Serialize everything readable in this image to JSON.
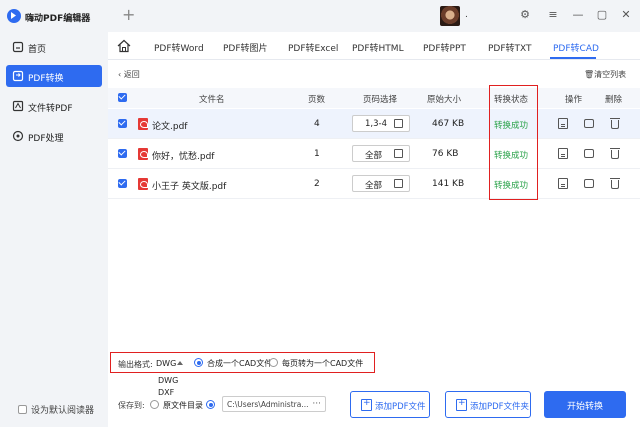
{
  "app": {
    "title": "嗨动PDF编辑器",
    "new_tab": "+",
    "username": "."
  },
  "window": {
    "minimize": "—",
    "restore": "▢",
    "close": "✕",
    "settings": "⚙",
    "menu": "≡"
  },
  "sidebar": {
    "items": [
      {
        "label": "首页",
        "icon": "home-icon"
      },
      {
        "label": "PDF转换",
        "icon": "convert-icon",
        "active": true
      },
      {
        "label": "文件转PDF",
        "icon": "file-to-pdf-icon"
      },
      {
        "label": "PDF处理",
        "icon": "pdf-process-icon"
      }
    ],
    "default_reader": "设为默认阅读器"
  },
  "tabs": [
    {
      "label": "PDF转Word"
    },
    {
      "label": "PDF转图片"
    },
    {
      "label": "PDF转Excel"
    },
    {
      "label": "PDF转HTML"
    },
    {
      "label": "PDF转PPT"
    },
    {
      "label": "PDF转TXT"
    },
    {
      "label": "PDF转CAD",
      "active": true
    }
  ],
  "toolbar": {
    "back": "返回",
    "clear": "清空列表"
  },
  "table": {
    "headers": {
      "filename": "文件名",
      "pages": "页数",
      "page_select": "页码选择",
      "size": "原始大小",
      "status": "转换状态",
      "actions": "操作",
      "delete": "删除"
    },
    "rows": [
      {
        "name": "论文.pdf",
        "pages": "4",
        "range": "1,3-4",
        "size": "467 KB",
        "status": "转换成功"
      },
      {
        "name": "你好，忧愁.pdf",
        "pages": "1",
        "range": "全部",
        "size": "76 KB",
        "status": "转换成功"
      },
      {
        "name": "小王子 英文版.pdf",
        "pages": "2",
        "range": "全部",
        "size": "141 KB",
        "status": "转换成功"
      }
    ]
  },
  "format": {
    "label": "输出格式:",
    "selected": "DWG",
    "options": [
      "DWG",
      "DXF"
    ],
    "merge_option": "合成一个CAD文件",
    "split_option": "每页转为一个CAD文件"
  },
  "save": {
    "label": "保存到:",
    "source_dir": "原文件目录",
    "path": "C:\\Users\\Administra...",
    "browse": "···"
  },
  "buttons": {
    "add_pdf": "添加PDF文件",
    "add_folder": "添加PDF文件夹",
    "convert": "开始转换"
  },
  "colors": {
    "accent": "#2e6bf0",
    "success": "#2aa34a",
    "highlight": "#e02020"
  }
}
